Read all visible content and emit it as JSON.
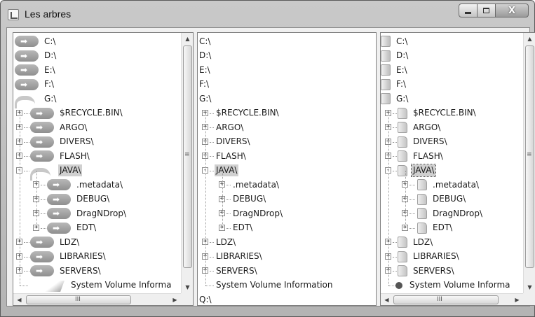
{
  "window": {
    "title": "Les arbres",
    "close_glyph": "X"
  },
  "pane1": {
    "drives": [
      "C:\\",
      "D:\\",
      "E:\\",
      "F:\\",
      "G:\\"
    ],
    "folders": [
      "$RECYCLE.BIN\\",
      "ARGO\\",
      "DIVERS\\",
      "FLASH\\",
      "JAVA\\"
    ],
    "java_children": [
      ".metadata\\",
      "DEBUG\\",
      "DragNDrop\\",
      "EDT\\"
    ],
    "after": [
      "LDZ\\",
      "LIBRARIES\\",
      "SERVERS\\"
    ],
    "system_volume": "System Volume Informa",
    "hscroll_grip": "III"
  },
  "pane2": {
    "drives": [
      "C:\\",
      "D:\\",
      "E:\\",
      "F:\\",
      "G:\\"
    ],
    "folders": [
      "$RECYCLE.BIN\\",
      "ARGO\\",
      "DIVERS\\",
      "FLASH\\",
      "JAVA\\"
    ],
    "java_children": [
      ".metadata\\",
      "DEBUG\\",
      "DragNDrop\\",
      "EDT\\"
    ],
    "after": [
      "LDZ\\",
      "LIBRARIES\\",
      "SERVERS\\"
    ],
    "system_volume": "System Volume Information",
    "last_drive": "Q:\\"
  },
  "pane3": {
    "drives": [
      "C:\\",
      "D:\\",
      "E:\\",
      "F:\\",
      "G:\\"
    ],
    "folders": [
      "$RECYCLE.BIN\\",
      "ARGO\\",
      "DIVERS\\",
      "FLASH\\",
      "JAVA\\"
    ],
    "java_children": [
      ".metadata\\",
      "DEBUG\\",
      "DragNDrop\\",
      "EDT\\"
    ],
    "after": [
      "LDZ\\",
      "LIBRARIES\\",
      "SERVERS\\"
    ],
    "system_volume": "System Volume Informa",
    "hscroll_grip": "III"
  },
  "icons": {
    "pane1_drive": "arrow-pill-icon",
    "pane1_expanded_drive": "drive-curve-icon",
    "pane3_drive": "drive-icon",
    "pane3_folder": "folder-icon",
    "pane3_system": "gear-bullet-icon",
    "pane1_system": "system-volume-icon"
  }
}
